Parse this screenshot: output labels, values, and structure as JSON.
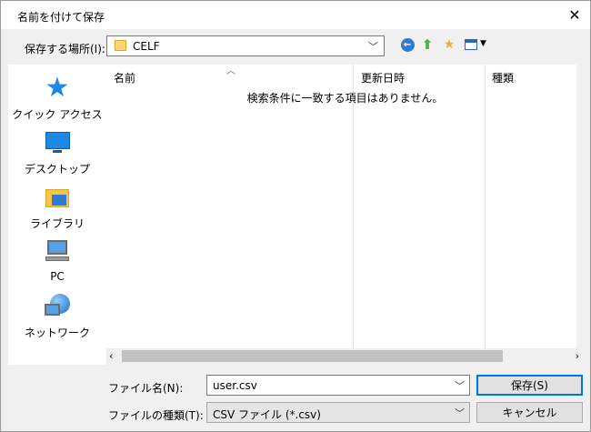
{
  "window": {
    "title": "名前を付けて保存"
  },
  "toolbar": {
    "location_label": "保存する場所(I):",
    "location_value": "CELF"
  },
  "nav": {
    "items": [
      {
        "label": "クイック アクセス",
        "icon": "star-icon"
      },
      {
        "label": "デスクトップ",
        "icon": "desktop-icon"
      },
      {
        "label": "ライブラリ",
        "icon": "library-icon"
      },
      {
        "label": "PC",
        "icon": "pc-icon"
      },
      {
        "label": "ネットワーク",
        "icon": "network-icon"
      }
    ]
  },
  "file_list": {
    "columns": [
      "名前",
      "更新日時",
      "種類"
    ],
    "empty_message": "検索条件に一致する項目はありません。"
  },
  "form": {
    "filename_label": "ファイル名(N):",
    "filename_value": "user.csv",
    "filetype_label": "ファイルの種類(T):",
    "filetype_value": "CSV ファイル (*.csv)"
  },
  "buttons": {
    "save": "保存(S)",
    "cancel": "キャンセル"
  },
  "colors": {
    "accent": "#0078d7",
    "folder": "#f8d775",
    "icon_blue": "#1e88e5"
  }
}
